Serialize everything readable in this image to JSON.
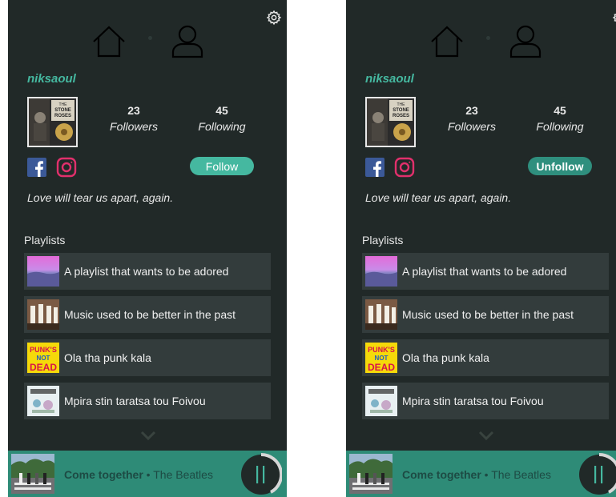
{
  "screens": [
    {
      "username": "niksaoul",
      "followers": {
        "count": "23",
        "label": "Followers"
      },
      "following": {
        "count": "45",
        "label": "Following"
      },
      "follow_button": "Follow",
      "bio": "Love will tear us apart, again.",
      "playlists_heading": "Playlists",
      "playlists": [
        {
          "name": "A playlist that wants to be adored"
        },
        {
          "name": "Music used to be better in the past"
        },
        {
          "name": "Ola tha punk kala"
        },
        {
          "name": "Mpira stin taratsa tou Foivou"
        }
      ],
      "now_playing": {
        "title": "Come together",
        "separator": " • ",
        "artist": "The Beatles"
      }
    },
    {
      "username": "niksaoul",
      "followers": {
        "count": "23",
        "label": "Followers"
      },
      "following": {
        "count": "45",
        "label": "Following"
      },
      "follow_button": "Unfollow",
      "bio": "Love will tear us apart, again.",
      "playlists_heading": "Playlists",
      "playlists": [
        {
          "name": "A playlist that wants to be adored"
        },
        {
          "name": "Music used to be better in the past"
        },
        {
          "name": "Ola tha punk kala"
        },
        {
          "name": "Mpira stin taratsa tou Foivou"
        }
      ],
      "now_playing": {
        "title": "Come together",
        "separator": " • ",
        "artist": "The Beatles"
      }
    }
  ],
  "avatar_cover_text": [
    "THE",
    "STONE",
    "ROSES"
  ],
  "playlist_thumb_text": {
    "punk": [
      "PUNK'S",
      "NOT",
      "DEAD"
    ]
  },
  "icons": [
    "gear-icon",
    "home-icon",
    "user-icon",
    "facebook-icon",
    "instagram-icon",
    "chevron-down-icon",
    "pause-icon"
  ],
  "colors": {
    "background": "#212928",
    "accent": "#45b8a0",
    "accent_dark": "#2f8f7e",
    "player": "#2e8b77",
    "row": "#333c3c"
  }
}
